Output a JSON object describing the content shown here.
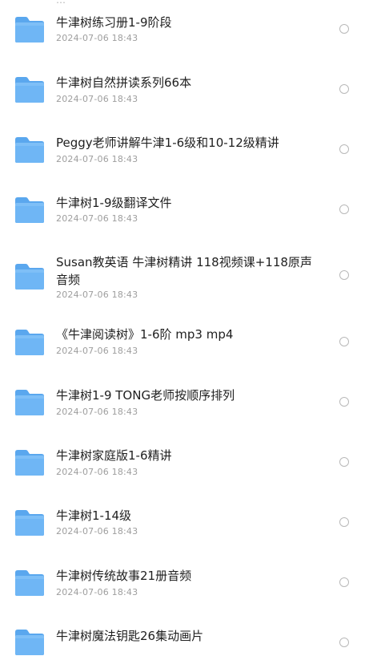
{
  "header": {
    "partial_text": "…"
  },
  "files": [
    {
      "name": "牛津树练习册1-9阶段",
      "date": "2024-07-06 18:43"
    },
    {
      "name": "牛津树自然拼读系列66本",
      "date": "2024-07-06 18:43"
    },
    {
      "name": "Peggy老师讲解牛津1-6级和10-12级精讲",
      "date": "2024-07-06 18:43"
    },
    {
      "name": "牛津树1-9级翻译文件",
      "date": "2024-07-06 18:43"
    },
    {
      "name": "Susan教英语 牛津树精讲 118视频课+118原声音频",
      "date": "2024-07-06 18:43"
    },
    {
      "name": "《牛津阅读树》1-6阶 mp3 mp4",
      "date": "2024-07-06 18:43"
    },
    {
      "name": "牛津树1-9 TONG老师按顺序排列",
      "date": "2024-07-06 18:43"
    },
    {
      "name": "牛津树家庭版1-6精讲",
      "date": "2024-07-06 18:43"
    },
    {
      "name": "牛津树1-14级",
      "date": "2024-07-06 18:43"
    },
    {
      "name": "牛津树传统故事21册音频",
      "date": "2024-07-06 18:43"
    },
    {
      "name": "牛津树魔法钥匙26集动画片",
      "date": ""
    }
  ],
  "icons": {
    "folder": "folder-icon",
    "checkbox": "radio-circle-icon",
    "grid": "grid-view-icon"
  },
  "colors": {
    "folder_body": "#6FB6F5",
    "folder_tab": "#5AA7EE",
    "text_primary": "#1f1f1f",
    "text_secondary": "#9e9e9e",
    "check_border": "#b9b9b9"
  }
}
